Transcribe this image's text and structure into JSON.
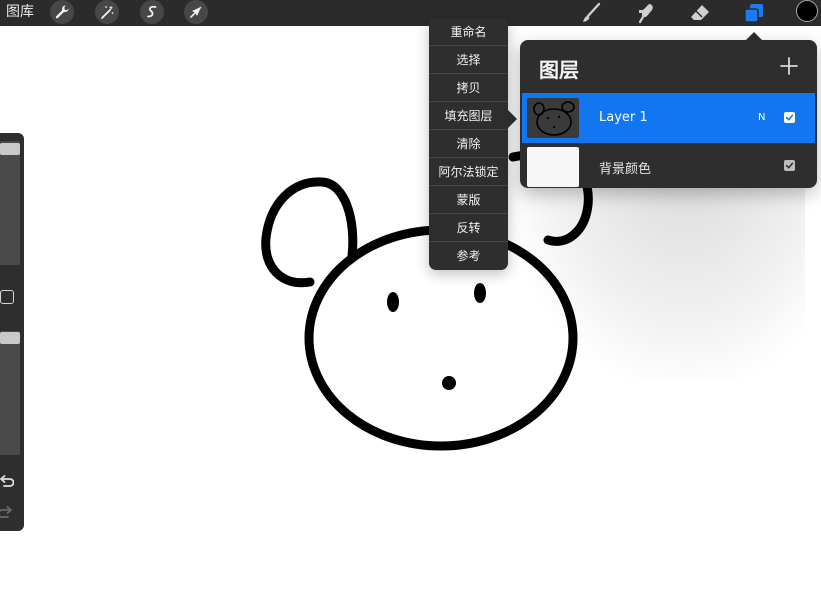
{
  "topbar": {
    "gallery_label": "图库",
    "left_tools": [
      "wrench-icon",
      "magic-wand-icon",
      "selection-icon",
      "transform-arrow-icon"
    ],
    "right_tools": [
      "brush-icon",
      "smudge-icon",
      "eraser-icon",
      "layers-icon"
    ],
    "active_tool": "layers-icon",
    "current_color": "#000000"
  },
  "sidebar": {
    "controls": [
      "brush-size-slider",
      "modify-button",
      "opacity-slider",
      "undo-icon",
      "redo-icon"
    ]
  },
  "context_menu": {
    "items": [
      "重命名",
      "选择",
      "拷贝",
      "填充图层",
      "清除",
      "阿尔法锁定",
      "蒙版",
      "反转",
      "参考"
    ]
  },
  "layers_panel": {
    "title": "图层",
    "add_icon": "plus-icon",
    "layers": [
      {
        "name": "Layer 1",
        "blend_mode": "N",
        "visible": true,
        "selected": true
      },
      {
        "name": "背景颜色",
        "blend_mode": "",
        "visible": true,
        "selected": false
      }
    ]
  },
  "colors": {
    "toolbar_bg": "#2b2b2b",
    "panel_bg": "#2e2e2e",
    "selection_blue": "#1176f0",
    "active_icon_blue": "#1a7cf5"
  }
}
